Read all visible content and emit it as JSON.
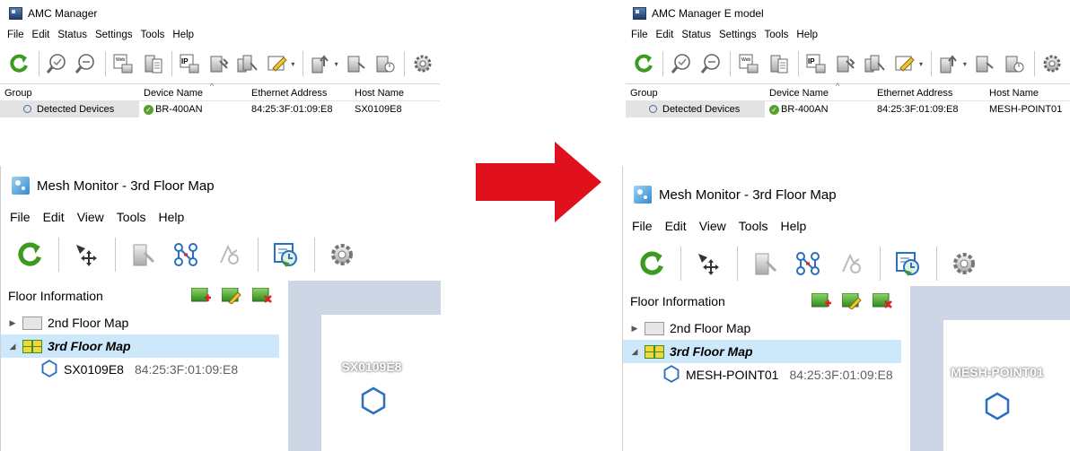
{
  "amc_left": {
    "title": "AMC Manager",
    "menu": [
      "File",
      "Edit",
      "Status",
      "Settings",
      "Tools",
      "Help"
    ],
    "columns": [
      "Group",
      "Device Name",
      "Ethernet Address",
      "Host Name"
    ],
    "group_item": "Detected Devices",
    "device": {
      "name": "BR-400AN",
      "ethernet": "84:25:3F:01:09:E8",
      "host": "SX0109E8"
    }
  },
  "amc_right": {
    "title": "AMC Manager E model",
    "menu": [
      "File",
      "Edit",
      "Status",
      "Settings",
      "Tools",
      "Help"
    ],
    "columns": [
      "Group",
      "Device Name",
      "Ethernet Address",
      "Host Name"
    ],
    "group_item": "Detected Devices",
    "device": {
      "name": "BR-400AN",
      "ethernet": "84:25:3F:01:09:E8",
      "host": "MESH-POINT01"
    }
  },
  "mesh_left": {
    "title": "Mesh Monitor - 3rd Floor Map",
    "menu": [
      "File",
      "Edit",
      "View",
      "Tools",
      "Help"
    ],
    "floor_info_label": "Floor Information",
    "floors": [
      {
        "name": "2nd Floor Map"
      },
      {
        "name": "3rd Floor Map"
      }
    ],
    "node": {
      "name": "SX0109E8",
      "mac": "84:25:3F:01:09:E8"
    },
    "map_label": "SX0109E8"
  },
  "mesh_right": {
    "title": "Mesh Monitor - 3rd Floor Map",
    "menu": [
      "File",
      "Edit",
      "View",
      "Tools",
      "Help"
    ],
    "floor_info_label": "Floor Information",
    "floors": [
      {
        "name": "2nd Floor Map"
      },
      {
        "name": "3rd Floor Map"
      }
    ],
    "node": {
      "name": "MESH-POINT01",
      "mac": "84:25:3F:01:09:E8"
    },
    "map_label": "MESH-POINT01"
  },
  "colors": {
    "arrow": "#e0101c",
    "canvas": "#ccd6e4",
    "selection": "#cde8fb",
    "node_hex": "#2a6fc0"
  }
}
